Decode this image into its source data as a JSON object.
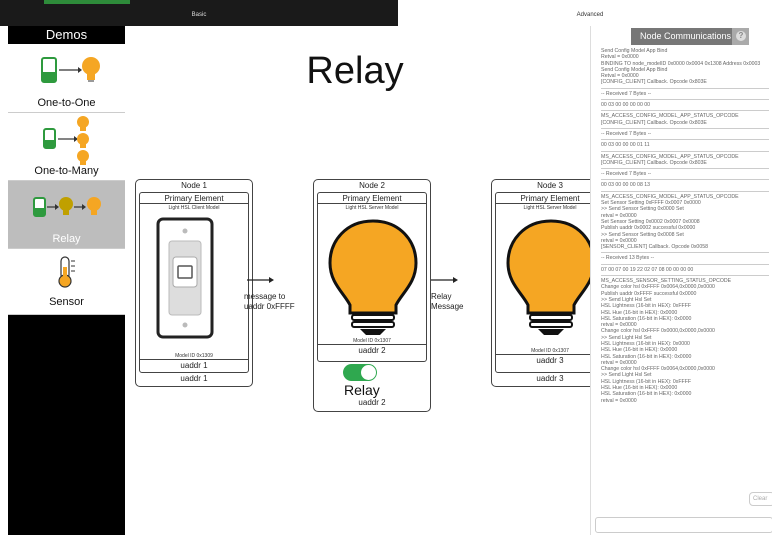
{
  "tabs": {
    "basic": "Basic",
    "advanced": "Advanced"
  },
  "sidebar": {
    "title": "Demos",
    "items": [
      {
        "label": "One-to-One"
      },
      {
        "label": "One-to-Many"
      },
      {
        "label": "Relay"
      },
      {
        "label": "Sensor"
      }
    ]
  },
  "main": {
    "title": "Relay",
    "nodes": [
      {
        "head": "Node 1",
        "element": "Primary Element",
        "model": "Light HSL Client Model",
        "model_id": "Model ID 0x1309",
        "uaddr_inner": "uaddr 1",
        "uaddr_outer": "uaddr 1"
      },
      {
        "head": "Node 2",
        "element": "Primary Element",
        "model": "Light HSL Server Model",
        "model_id": "Model ID 0x1307",
        "uaddr_inner": "uaddr 2",
        "uaddr_outer": "uaddr 2"
      },
      {
        "head": "Node 3",
        "element": "Primary Element",
        "model": "Light HSL Server Model",
        "model_id": "Model ID 0x1307",
        "uaddr_inner": "uaddr 3",
        "uaddr_outer": "uaddr 3"
      }
    ],
    "arrow1_label": "message to uaddr 0xFFFF",
    "arrow2_label": "Relay Message",
    "relay_toggle_label": "Relay",
    "relay_toggle_on": true
  },
  "panel": {
    "title": "Node Communications",
    "help": "?",
    "clear": "Clear",
    "log": [
      "Send Config Model App Bind",
      "Retval = 0x0000",
      "BINDING TO node_modelID 0x0000 0x0004 0x1308  Address 0x0003",
      "Send Config Model App Bind",
      "Retval = 0x0000",
      "[CONFIG_CLIENT] Callback. Opcode 0x803E",
      "-- Received 7 Bytes --",
      "00 03 00 00 00 00 00",
      "MS_ACCESS_CONFIG_MODEL_APP_STATUS_OPCODE",
      "[CONFIG_CLIENT] Callback. Opcode 0x803E",
      "-- Received 7 Bytes --",
      "00 03 00 00 00 01 11",
      "MS_ACCESS_CONFIG_MODEL_APP_STATUS_OPCODE",
      "[CONFIG_CLIENT] Callback. Opcode 0x803E",
      "-- Received 7 Bytes --",
      "00 03 00 00 00 08 13",
      "MS_ACCESS_CONFIG_MODEL_APP_STATUS_OPCODE",
      "Set Sensor Setting 0xFFFF 0x0007 0x0000",
      ">> Send Sensor Setting 0x0000 Set",
      "retval = 0x0000",
      "Set Sensor Setting 0x0002 0x0007 0x0008",
      "Publish uaddr 0x0002 successful 0x0000",
      ">> Send Sensor Setting 0x0008 Set",
      "retval = 0x0000",
      "[SENSOR_CLIENT] Callback. Opcode 0x0058",
      "-- Received 13 Bytes --",
      "07 00 07 00 19 22 02 07 08 00 00 00 00",
      "MS_ACCESS_SENSOR_SETTING_STATUS_OPCODE",
      "Change color hsl 0xFFFF 0x0064,0x0000,0x0000",
      "Publish uaddr 0xFFFF successful 0x0000",
      ">> Send Light Hsl Set",
      "HSL Lightness (16-bit in HEX): 0xFFFF",
      "HSL Hue (16-bit in HEX): 0x0000",
      "HSL Saturation (16-bit in HEX): 0x0000",
      "retval = 0x0000",
      "Change color hsl 0xFFFF 0x0000,0x0000,0x0000",
      ">> Send Light Hsl Set",
      "HSL Lightness (16-bit in HEX): 0x0000",
      "HSL Hue (16-bit in HEX): 0x0000",
      "HSL Saturation (16-bit in HEX): 0x0000",
      "retval = 0x0000",
      "Change color hsl 0xFFFF 0x0064,0x0000,0x0000",
      ">> Send Light Hsl Set",
      "HSL Lightness (16-bit in HEX): 0xFFFF",
      "HSL Hue (16-bit in HEX): 0x0000",
      "HSL Saturation (16-bit in HEX): 0x0000",
      "retval = 0x0000"
    ]
  },
  "colors": {
    "accent_green": "#2fa84f",
    "bulb_orange": "#f5a623",
    "device_green": "#2e9a3e"
  }
}
